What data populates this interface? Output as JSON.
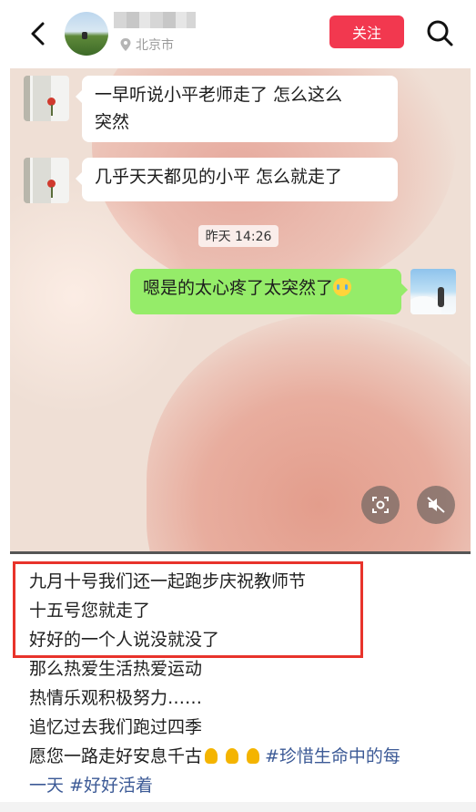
{
  "header": {
    "location": "北京市",
    "follow_label": "关注"
  },
  "chat": {
    "messages": [
      {
        "side": "left",
        "lines": [
          "一早听说小平老师走了 怎么这么",
          "突然"
        ]
      },
      {
        "side": "left",
        "lines": [
          "几乎天天都见的小平 怎么就走了"
        ]
      },
      {
        "side": "right",
        "lines": [
          "嗯是的太心疼了太突然了"
        ]
      }
    ],
    "timestamp": "昨天 14:26"
  },
  "caption": {
    "highlighted_lines": [
      "九月十号我们还一起跑步庆祝教师节",
      "十五号您就走了",
      "好好的一个人说没就没了"
    ],
    "lines": [
      "那么热爱生活热爱运动",
      "热情乐观积极努力……",
      "追忆过去我们跑过四季"
    ],
    "last_line_text": "愿您一路走好安息千古",
    "last_line_tag": "#珍惜生命中的每",
    "final_line_tag_1": "一天",
    "final_line_tag_2": "#好好活着"
  },
  "icons": {
    "back": "back-arrow-icon",
    "location": "location-pin-icon",
    "search": "search-icon",
    "scan": "scan-icon",
    "mute": "mute-icon"
  },
  "colors": {
    "follow": "#f2384f",
    "highlight_box": "#e8332b",
    "right_bubble": "#95ec69",
    "hashtag": "#3c5a96"
  },
  "video_progress": 1.0
}
